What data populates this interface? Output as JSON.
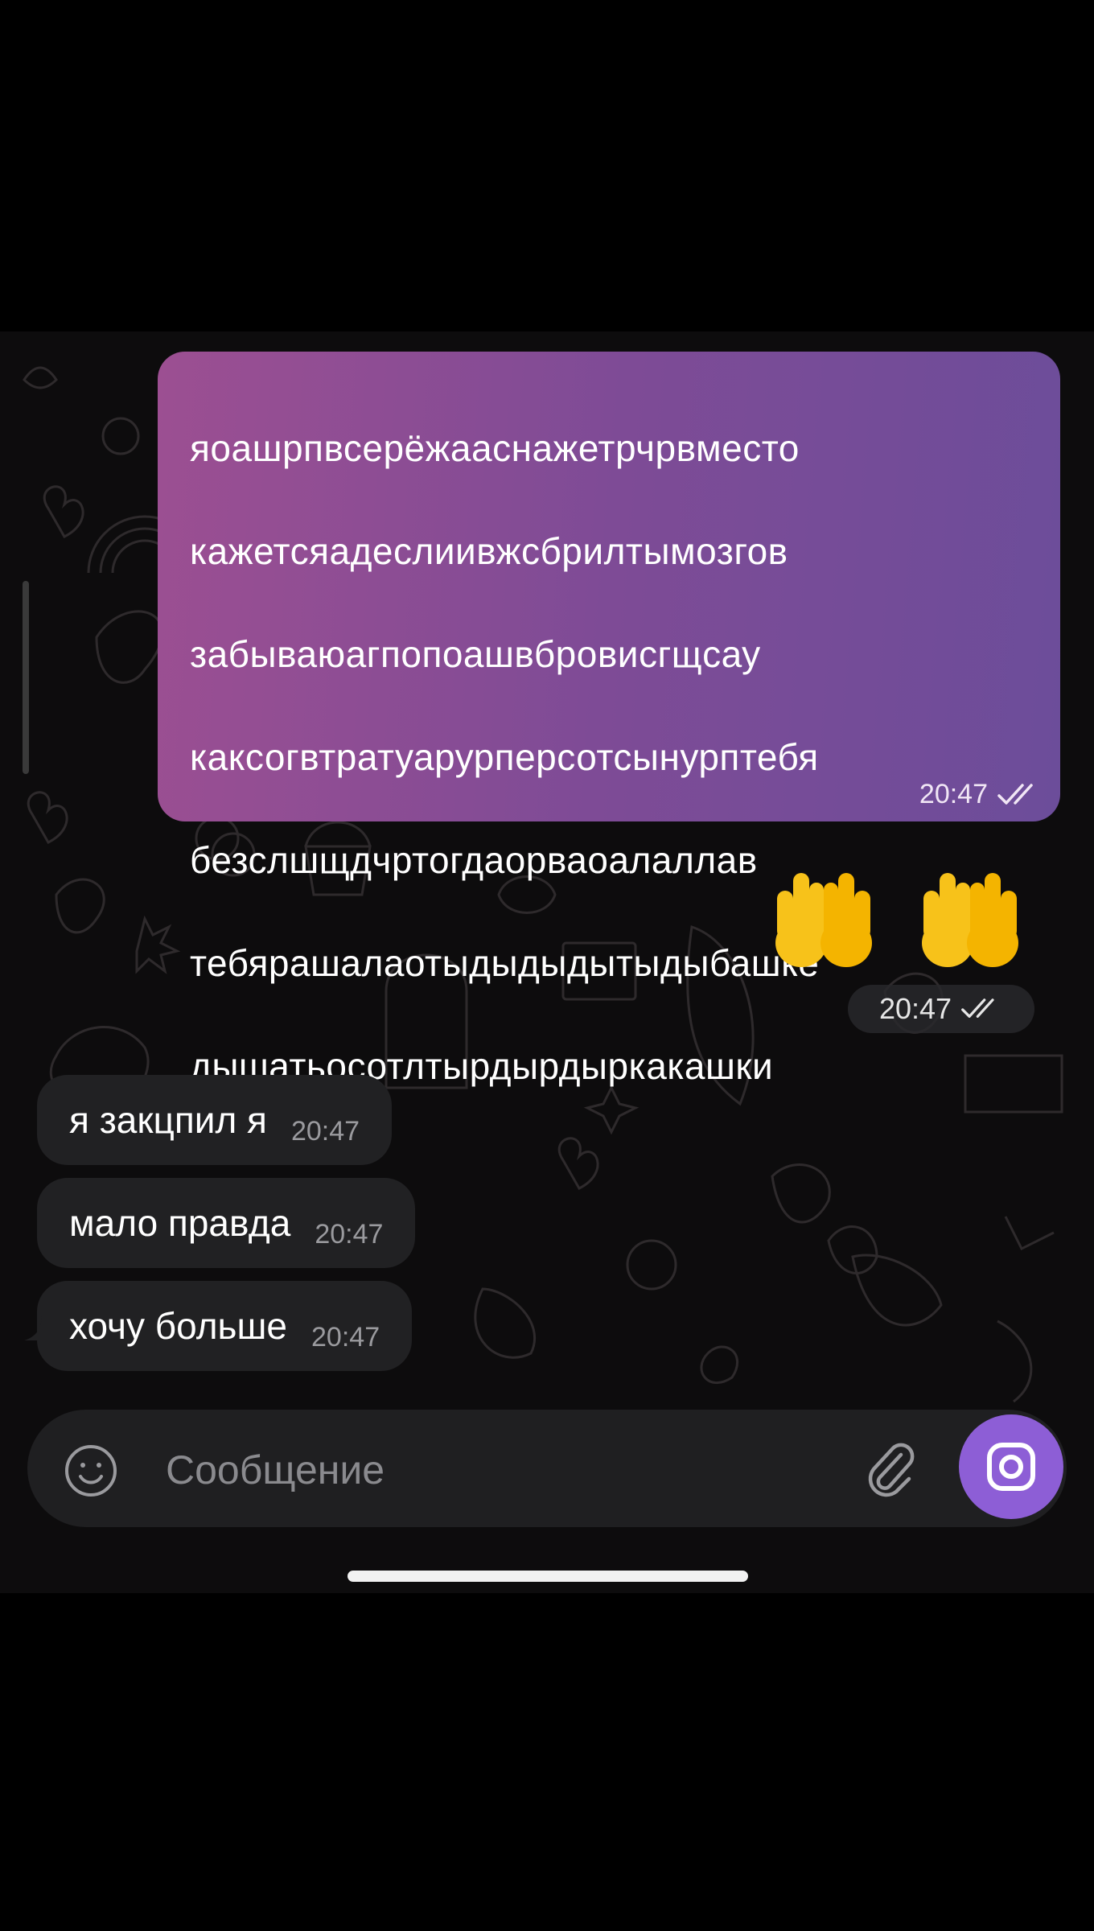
{
  "outgoing_message": {
    "lines": [
      "яоашрпвсерёжааснажетрчрвместо",
      "кажетсяадеслиивжсбрилтымозгов",
      "забываюагпопоашвбровисгщсау",
      "каксогвтратуарурперсотсынурптебя",
      "безслшщдчртогдаорваоалаллав",
      "тебярашалаотыдыдыдытыдыбашке",
      "дышатьосотлтырдырдыркакашки"
    ],
    "time": "20:47",
    "status_icon": "double-check-icon"
  },
  "sticker_message": {
    "emoji": [
      "raised-back-of-hand-icon",
      "raised-back-of-hand-icon"
    ],
    "time": "20:47",
    "status_icon": "double-check-icon"
  },
  "incoming_messages": [
    {
      "text": "я закцпил я",
      "time": "20:47"
    },
    {
      "text": "мало правда",
      "time": "20:47"
    },
    {
      "text": "хочу больше",
      "time": "20:47"
    }
  ],
  "composer": {
    "placeholder": "Сообщение",
    "emoji_icon": "smile-icon",
    "attach_icon": "paperclip-icon",
    "send_icon": "camera-icon",
    "accent": "#8d5ed6"
  },
  "colors": {
    "outgoing_gradient_start": "#9c4f92",
    "outgoing_gradient_end": "#6c4d9a",
    "incoming_bubble": "#212123",
    "background": "#000000"
  }
}
